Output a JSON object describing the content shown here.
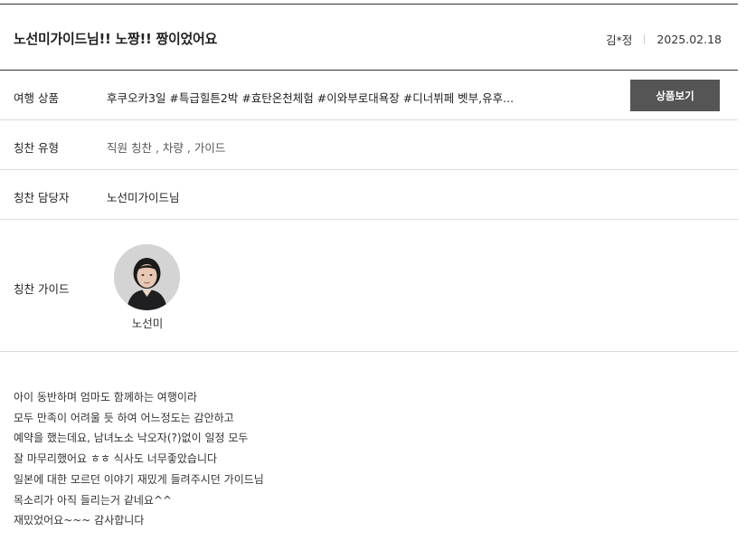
{
  "review": {
    "title": "노선미가이드님!! 노짱!! 짱이었어요",
    "author": "김*정",
    "date": "2025.02.18"
  },
  "product": {
    "label": "여행 상품",
    "name": "후쿠오카3일 #특급힐튼2박 #효탄온천체험 #이와부로대욕장 #디너뷔페 벳부,유후...",
    "button_label": "상품보기"
  },
  "praise_type": {
    "label": "칭찬 유형",
    "value": "직원 칭찬 , 차량 , 가이드"
  },
  "praise_staff": {
    "label": "칭찬 담당자",
    "value": "노선미가이드님"
  },
  "praise_guide": {
    "label": "칭찬 가이드",
    "name": "노선미"
  },
  "body_lines": [
    "아이 동반하며 엄마도 함께하는 여행이라",
    "모두 만족이 어려울 듯 하여 어느정도는 감안하고",
    "예약을 했는데요, 남녀노소 낙오자(?)없이 일정 모두",
    "잘 마무리했어요 ㅎㅎ 식사도 너무좋았습니다",
    "일본에 대한 모르던 이야기 재밌게 들려주시던 가이드님",
    "목소리가 아직 들리는거 같네요^^",
    "재밌었어요~~~ 감사합니다"
  ]
}
